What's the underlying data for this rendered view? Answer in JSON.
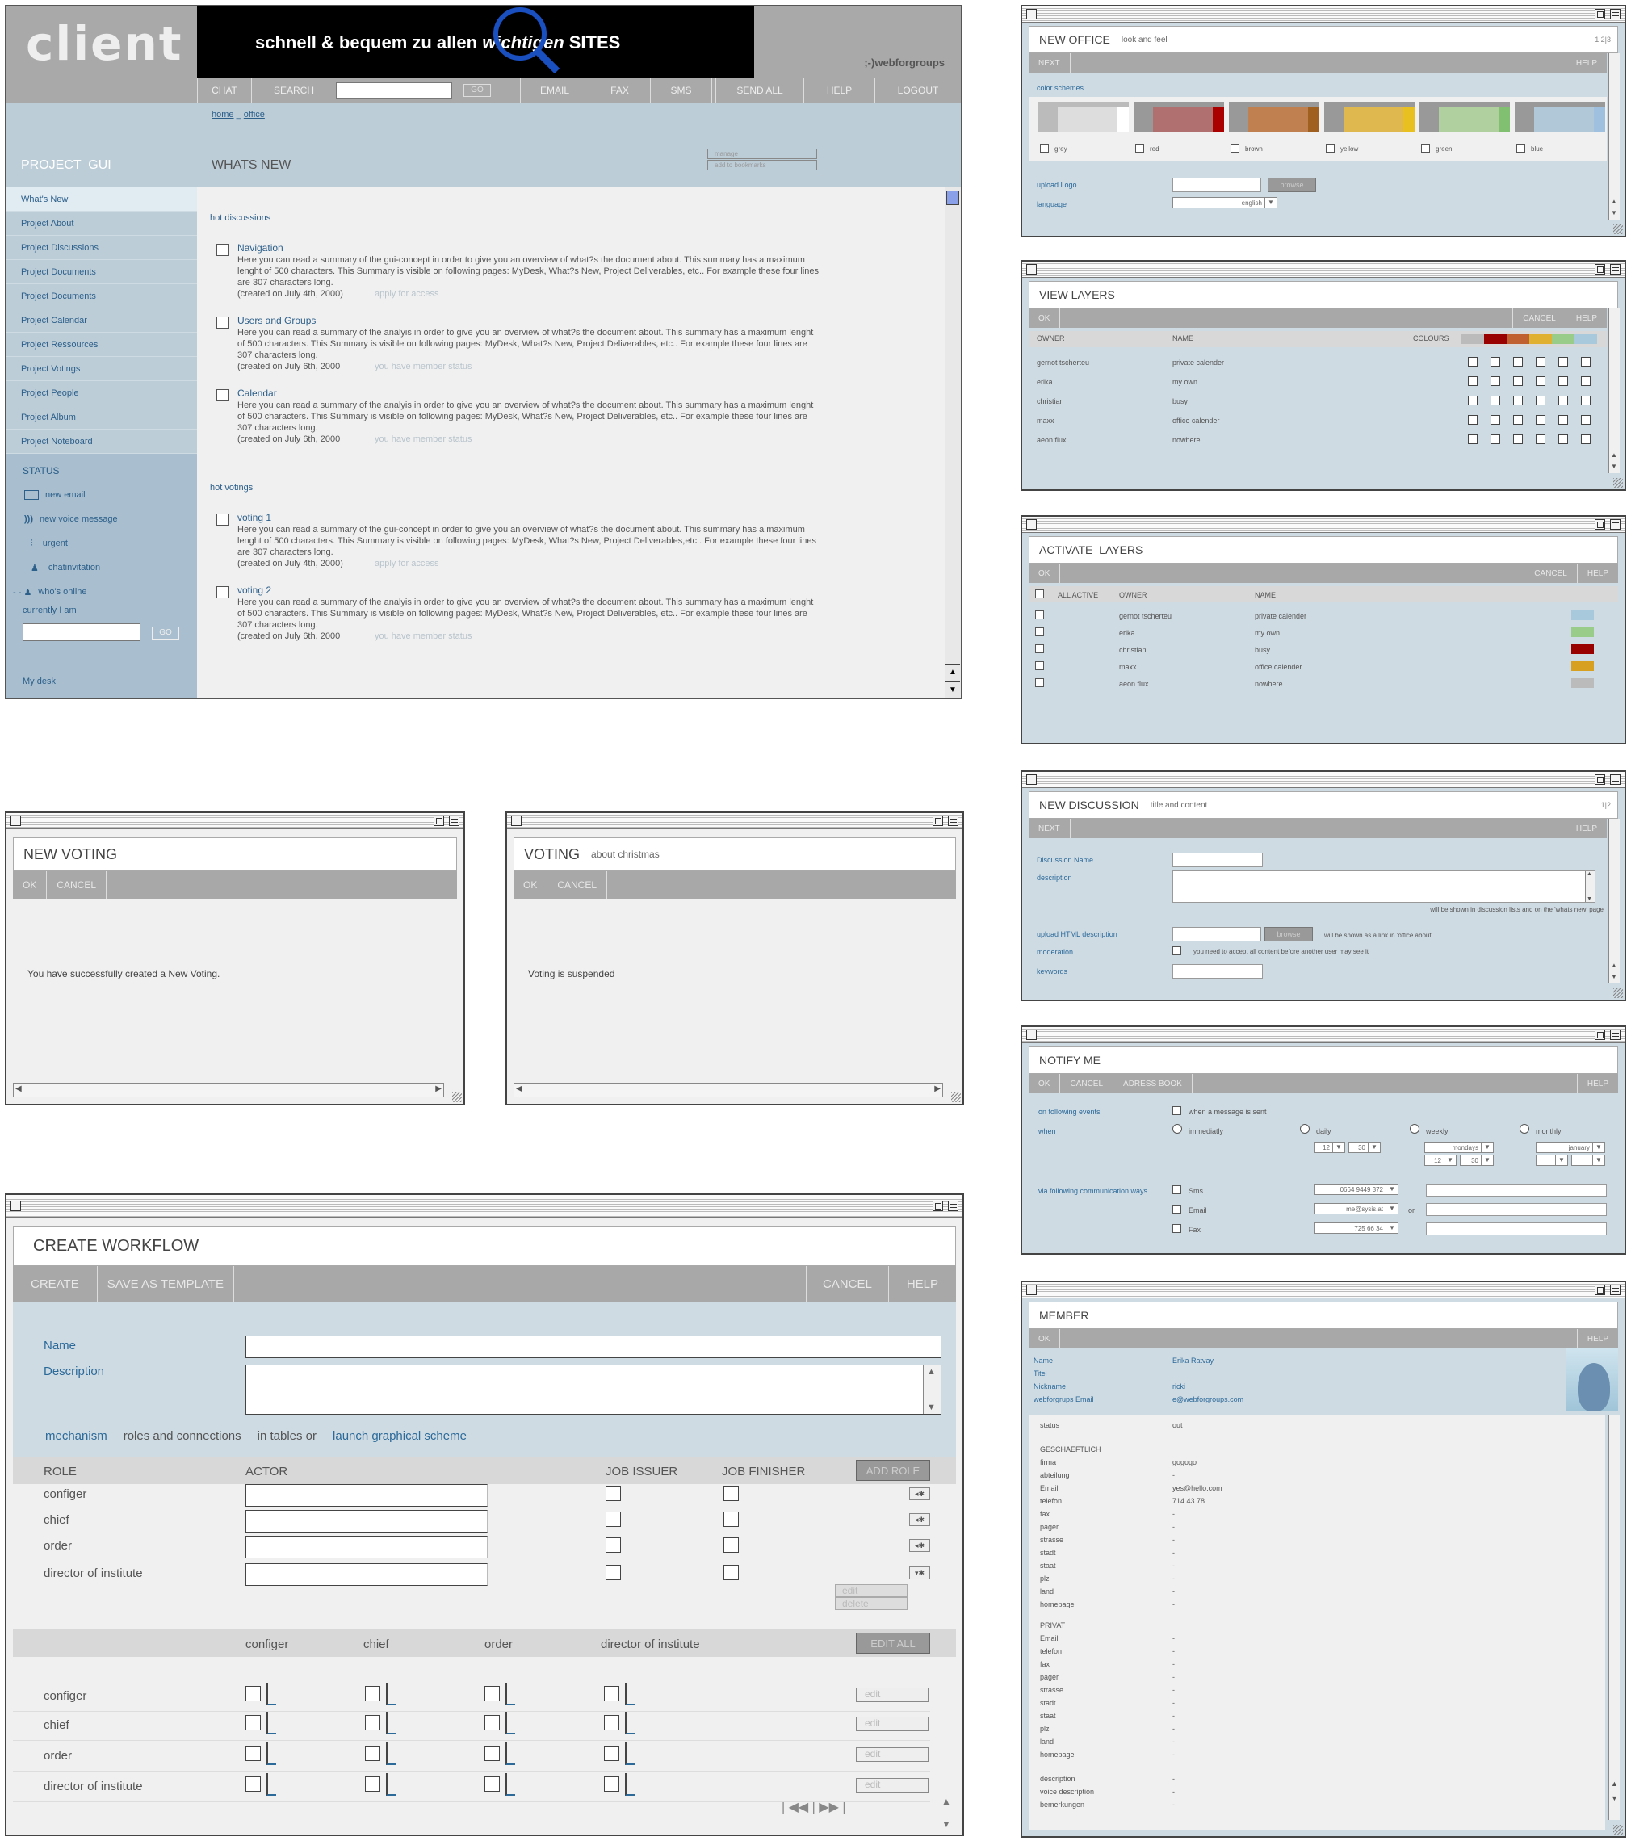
{
  "main": {
    "logo": "client",
    "banner_pre": "schnell & bequem zu allen ",
    "banner_w": "wichtigen",
    "banner_post": " SITES",
    "brand": ";-)webforgroups",
    "nav": [
      "CHAT",
      "SEARCH",
      "GO",
      "EMAIL",
      "FAX",
      "SMS",
      "SEND ALL",
      "HELP",
      "LOGOUT"
    ],
    "breadcrumb_home": "home",
    "breadcrumb_sep": "_",
    "breadcrumb_office": "office",
    "project": "PROJECT  GUI",
    "page_title": "WHATS NEW",
    "manage": "manage",
    "bookmarks": "add to bookmarks",
    "sidebar": [
      "What's New",
      "Project About",
      "Project Discussions",
      "Project Documents",
      "Project Documents",
      "Project Calendar",
      "Project Ressources",
      "Project Votings",
      "Project People",
      "Project Album",
      "Project Noteboard"
    ],
    "status_title": "STATUS",
    "status": [
      "new email",
      "new voice message",
      "urgent",
      "chatinvitation",
      "who's online"
    ],
    "currently": "currently I am",
    "go": "GO",
    "mydesk": "My desk",
    "hot_discussions": "hot discussions",
    "hot_votings": "hot votings",
    "discussions": [
      {
        "title": "Navigation",
        "l1": "Here you can read a summary of the gui-concept in order to give you an overview of what?s the document about. This summary has a maximum",
        "l2": "lenght of 500 characters. This Summary is visible on following pages: MyDesk, What?s New, Project Deliverables, etc.. For example these four lines",
        "l3": "are 307 characters long.",
        "created": "(created on July 4th, 2000)",
        "status": "apply for access"
      },
      {
        "title": "Users and Groups",
        "l1": "Here you can read a summary of the analyis in order to give you an overview of what?s the document about. This summary has a maximum lenght",
        "l2": "of 500 characters. This Summary is visible on following pages: MyDesk, What?s New, Project Deliverables, etc.. For example these four lines are",
        "l3": "307 characters long.",
        "created": "(created on July 6th, 2000",
        "status": "you have member status"
      },
      {
        "title": "Calendar",
        "l1": "Here you can read a summary of the analyis in order to give you an overview of what?s the document about. This summary has a maximum lenght",
        "l2": "of 500 characters. This Summary is visible on following pages: MyDesk, What?s New, Project Deliverables, etc.. For example these four lines are",
        "l3": "307 characters long.",
        "created": "(created on July 6th, 2000",
        "status": "you have member status"
      }
    ],
    "votings": [
      {
        "title": "voting 1",
        "l1": "Here you can read a summary of the gui-concept in order to give you an overview of what?s the document about. This summary has a maximum",
        "l2": "lenght of 500 characters. This Summary is visible on following pages: MyDesk, What?s New, Project Deliverables,etc.. For example these four lines",
        "l3": "are 307 characters long.",
        "created": "(created on July 4th, 2000)",
        "status": "apply for access"
      },
      {
        "title": "voting 2",
        "l1": "Here you can read a summary of the analyis in order to give you an overview of what?s the document about. This summary has a maximum lenght",
        "l2": "of 500 characters. This Summary is visible on following pages: MyDesk, What?s New, Project Deliverables, etc.. For example these four lines are",
        "l3": "307 characters long.",
        "created": "(created on July 6th, 2000",
        "status": "you have member status"
      }
    ]
  },
  "new_voting": {
    "title": "NEW VOTING",
    "ok": "OK",
    "cancel": "CANCEL",
    "message": "You have successfully created a New Voting."
  },
  "voting": {
    "title": "VOTING",
    "sub": "about christmas",
    "ok": "OK",
    "cancel": "CANCEL",
    "message": "Voting is suspended"
  },
  "workflow": {
    "title": "CREATE WORKFLOW",
    "create": "CREATE",
    "template": "SAVE AS TEMPLATE",
    "cancel": "CANCEL",
    "help": "HELP",
    "name": "Name",
    "description": "Description",
    "mechanism": "mechanism",
    "roles": "roles and connections",
    "in_tables": "in tables or",
    "launch": "launch graphical scheme",
    "col_role": "ROLE",
    "col_actor": "ACTOR",
    "col_issuer": "JOB ISSUER",
    "col_finisher": "JOB FINISHER",
    "add_role": "ADD ROLE",
    "roles_list": [
      "configer",
      "chief",
      "order",
      "director of institute"
    ],
    "edit": "edit",
    "delete": "delete",
    "edit_all": "EDIT ALL"
  },
  "new_office": {
    "title": "NEW OFFICE",
    "sub": "look and feel",
    "pages": "1|2|3",
    "next": "NEXT",
    "help": "HELP",
    "color_schemes": "color schemes",
    "schemes": [
      {
        "name": "grey",
        "c": [
          "#bbb",
          "#ddd",
          "#e8e8e8"
        ],
        "a": "#fff"
      },
      {
        "name": "red",
        "c": [
          "#999",
          "#b07070",
          "#b07070"
        ],
        "a": "#a00"
      },
      {
        "name": "brown",
        "c": [
          "#999",
          "#c08050",
          "#c08050"
        ],
        "a": "#a06020"
      },
      {
        "name": "yellow",
        "c": [
          "#999",
          "#e0b850",
          "#e0b850"
        ],
        "a": "#e8c020"
      },
      {
        "name": "green",
        "c": [
          "#999",
          "#b0d0a0",
          "#b0d0a0"
        ],
        "a": "#80c070"
      },
      {
        "name": "blue",
        "c": [
          "#999",
          "#b0c8d8",
          "#b0c8d8"
        ],
        "a": "#a0c0e0"
      }
    ],
    "upload_logo": "upload Logo",
    "browse": "browse",
    "language": "language",
    "language_value": "english"
  },
  "view_layers": {
    "title": "VIEW LAYERS",
    "ok": "OK",
    "cancel": "CANCEL",
    "help": "HELP",
    "owner": "OWNER",
    "name": "NAME",
    "colours": "COLOURS",
    "rows": [
      [
        "gernot tscherteu",
        "private calender"
      ],
      [
        "erika",
        "my own"
      ],
      [
        "christian",
        "busy"
      ],
      [
        "maxx",
        "office calender"
      ],
      [
        "aeon flux",
        "nowhere"
      ]
    ]
  },
  "activate_layers": {
    "title": "ACTIVATE  LAYERS",
    "ok": "OK",
    "cancel": "CANCEL",
    "help": "HELP",
    "all_active": "ALL ACTIVE",
    "owner": "OWNER",
    "name": "NAME",
    "rows": [
      [
        "gernot tscherteu",
        "private calender",
        "#a8c8dc"
      ],
      [
        "erika",
        "my own",
        "#98cc88"
      ],
      [
        "christian",
        "busy",
        "#900"
      ],
      [
        "maxx",
        "office calender",
        "#d8a020"
      ],
      [
        "aeon flux",
        "nowhere",
        "#bbb"
      ]
    ]
  },
  "new_discussion": {
    "title": "NEW DISCUSSION",
    "sub": "title and content",
    "pages": "1|2",
    "next": "NEXT",
    "help": "HELP",
    "disc_name": "Discussion Name",
    "description": "description",
    "hint": "will be shown in discussion lists and on the 'whats new' page",
    "upload": "upload HTML description",
    "browse": "browse",
    "upload_hint": "will be shown as a link in 'office about'",
    "moderation": "moderation",
    "moderation_hint": "you need to accept all content before another user may see it",
    "keywords": "keywords"
  },
  "notify": {
    "title": "NOTIFY ME",
    "ok": "OK",
    "cancel": "CANCEL",
    "address": "ADRESS BOOK",
    "help": "HELP",
    "events": "on following events",
    "when_sent": "when a message is sent",
    "when": "when",
    "immediatly": "immediatly",
    "daily": "daily",
    "weekly": "weekly",
    "monthly": "monthly",
    "h": "12",
    "m": "30",
    "mondays": "mondays",
    "january": "january",
    "via": "via following communication ways",
    "sms": "Sms",
    "email": "Email",
    "fax": "Fax",
    "sms_v": "0664 9449 372",
    "email_v": "me@sysis.at",
    "fax_v": "725 66 34",
    "or": "or"
  },
  "member": {
    "title": "MEMBER",
    "ok": "OK",
    "help": "HELP",
    "top": [
      [
        "Name",
        "Erika Ratvay"
      ],
      [
        "Titel",
        ""
      ],
      [
        "Nickname",
        "ricki"
      ],
      [
        "webforgrups Email",
        "e@webforgroups.com"
      ]
    ],
    "status": "status",
    "status_v": "out",
    "geschaeftlich": "GESCHAEFTLICH",
    "g": [
      [
        "firma",
        "gogogo"
      ],
      [
        "abteilung",
        "-"
      ],
      [
        "Email",
        "yes@hello.com"
      ],
      [
        "telefon",
        "714 43 78"
      ],
      [
        "fax",
        "-"
      ],
      [
        "pager",
        "-"
      ],
      [
        "strasse",
        "-"
      ],
      [
        "stadt",
        "-"
      ],
      [
        "staat",
        "-"
      ],
      [
        "plz",
        "-"
      ],
      [
        "land",
        "-"
      ],
      [
        "homepage",
        "-"
      ]
    ],
    "privat": "PRIVAT",
    "p": [
      [
        "Email",
        "-"
      ],
      [
        "telefon",
        "-"
      ],
      [
        "fax",
        "-"
      ],
      [
        "pager",
        "-"
      ],
      [
        "strasse",
        "-"
      ],
      [
        "stadt",
        "-"
      ],
      [
        "staat",
        "-"
      ],
      [
        "plz",
        "-"
      ],
      [
        "land",
        "-"
      ],
      [
        "homepage",
        "-"
      ]
    ],
    "extra": [
      [
        "description",
        "-"
      ],
      [
        "voice description",
        "-"
      ],
      [
        "bemerkungen",
        "-"
      ]
    ]
  }
}
